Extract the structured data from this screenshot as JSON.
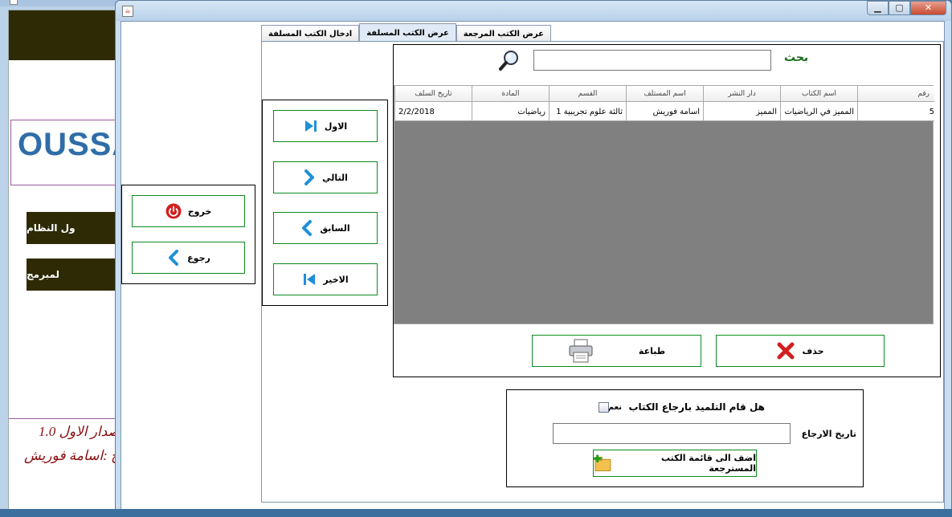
{
  "background_window": {
    "logo_text": "OUSSA",
    "buttons": [
      "ول النظام",
      "لمبرمج"
    ],
    "version_text": "صدار الاول 1.0",
    "author_text": "ج :اسامة فوريش"
  },
  "window": {
    "minimize": "▁",
    "maximize": "▢",
    "close": "✕"
  },
  "tabs": [
    "عرض الكتب المرجعة",
    "عرض الكتب المسلفة",
    "ادخال الكتب المسلفة"
  ],
  "active_tab": 1,
  "exit_panel": {
    "exit_label": "خروج",
    "back_label": "رجوع"
  },
  "navigation": {
    "first_label": "الاول",
    "next_label": "التالي",
    "previous_label": "السابق",
    "last_label": "الاخير"
  },
  "search": {
    "label": "بحث",
    "value": ""
  },
  "table": {
    "headers": [
      "رقم",
      "اسم الكتاب",
      "دار النشر",
      "اسم المستلف",
      "القسم",
      "المادة",
      "تاريخ السلف"
    ],
    "rows": [
      [
        "5",
        "المميز في الرياضيات",
        "المميز",
        "اسامة فوريش",
        "ثالثة علوم تجريبية 1",
        "رياضيات",
        "2/2/2018"
      ]
    ]
  },
  "actions": {
    "delete_label": "حذف",
    "print_label": "طباعة"
  },
  "return_panel": {
    "question": "هل قام التلميذ بارجاع الكتاب",
    "yes_label": "نعم",
    "yes_checked": false,
    "return_date_label": "تاريخ الارجاع",
    "return_date_value": "",
    "add_button_label": "اضف الى قائمة الكتب المسترجعة"
  },
  "colors": {
    "button_border": "#0c8a20",
    "dark_header": "#2d2a05",
    "search_label": "#1a6a1a"
  }
}
